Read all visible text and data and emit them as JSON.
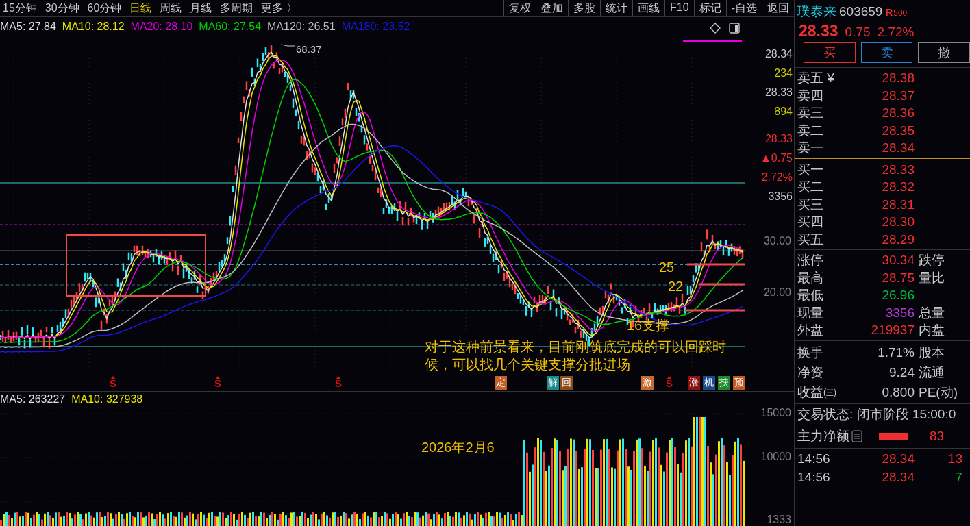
{
  "toolbar": {
    "periods": [
      {
        "label": "15分钟",
        "selected": false
      },
      {
        "label": "30分钟",
        "selected": false
      },
      {
        "label": "60分钟",
        "selected": false
      },
      {
        "label": "日线",
        "selected": true
      },
      {
        "label": "周线",
        "selected": false
      },
      {
        "label": "月线",
        "selected": false
      },
      {
        "label": "多周期",
        "selected": false
      },
      {
        "label": "更多 〉",
        "selected": false
      }
    ],
    "buttons": [
      "复权",
      "叠加",
      "多股",
      "统计",
      "画线",
      "F10",
      "标记",
      "-自选",
      "返回"
    ]
  },
  "legend": [
    {
      "text": "MA5: 27.84",
      "color": "#e0e0e0"
    },
    {
      "text": "MA10: 28.12",
      "color": "#e8e800"
    },
    {
      "text": "MA20: 28.10",
      "color": "#e000e0"
    },
    {
      "text": "MA60: 27.54",
      "color": "#00d000"
    },
    {
      "text": "MA120: 26.51",
      "color": "#bdbdbd"
    },
    {
      "text": "MA180: 23.52",
      "color": "#1818e8"
    }
  ],
  "peak_label": "68.37",
  "price_axis": {
    "info": [
      {
        "text": "28.34",
        "kind": "plain"
      },
      {
        "text": "234",
        "kind": "volume"
      },
      {
        "text": "28.33",
        "kind": "plain"
      },
      {
        "text": "894",
        "kind": "volume"
      },
      {
        "text": "28.33",
        "kind": "up"
      },
      {
        "text": "▲0.75",
        "kind": "up"
      },
      {
        "text": "2.72%",
        "kind": "up"
      },
      {
        "text": "3356",
        "kind": "plain"
      }
    ],
    "ticks": [
      "30.00",
      "20.00"
    ]
  },
  "markers": [
    {
      "kind": "s",
      "label": "S"
    },
    {
      "kind": "s",
      "label": "S"
    },
    {
      "kind": "s",
      "label": "S"
    },
    {
      "kind": "tag",
      "label": "定",
      "color": "#c0602a"
    },
    {
      "kind": "tag",
      "label": "解",
      "color": "#1a8a8a"
    },
    {
      "kind": "tag",
      "label": "回",
      "color": "#8a4a1a"
    },
    {
      "kind": "tag",
      "label": "激",
      "color": "#c8682e"
    },
    {
      "kind": "s",
      "label": "S"
    },
    {
      "kind": "tag",
      "label": "涨",
      "color": "#8a1010"
    },
    {
      "kind": "tag",
      "label": "机",
      "color": "#1a4a8a"
    },
    {
      "kind": "tag",
      "label": "扶",
      "color": "#1a8a2a"
    },
    {
      "kind": "tag",
      "label": "预",
      "color": "#c05a20"
    }
  ],
  "annotations": {
    "labels": [
      "25",
      "22",
      "16支撑"
    ],
    "note": "对于这种前景看来，目前刚筑底完成的可以回踩时候，可以找几个关键支撑分批进场"
  },
  "volume": {
    "legend": [
      {
        "text": "MA5: 263227",
        "color": "#e0e0e0"
      },
      {
        "text": "MA10: 327938",
        "color": "#e8e800"
      }
    ],
    "note": "2026年2月6",
    "ticks": [
      "15000",
      "10000",
      "1333"
    ]
  },
  "panel": {
    "name": "璞泰来",
    "code": "603659",
    "badge_letter": "R",
    "badge": "500",
    "quote": {
      "price": "28.33",
      "change": "0.75",
      "percent": "2.72%"
    },
    "actions": [
      {
        "label": "买",
        "kind": "buy"
      },
      {
        "label": "卖",
        "kind": "sell"
      },
      {
        "label": "撤",
        "kind": "cancel"
      }
    ],
    "asks": [
      {
        "label": "卖五 ¥",
        "price": "28.38"
      },
      {
        "label": "卖四",
        "price": "28.37"
      },
      {
        "label": "卖三",
        "price": "28.36"
      },
      {
        "label": "卖二",
        "price": "28.35"
      },
      {
        "label": "卖一",
        "price": "28.34"
      }
    ],
    "bids": [
      {
        "label": "买一",
        "price": "28.33"
      },
      {
        "label": "买二",
        "price": "28.32"
      },
      {
        "label": "买三",
        "price": "28.31"
      },
      {
        "label": "买四",
        "price": "28.30"
      },
      {
        "label": "买五",
        "price": "28.29"
      }
    ],
    "stats": [
      {
        "label": "涨停",
        "value": "30.34",
        "color": "#f03030",
        "label2": "跌停"
      },
      {
        "label": "最高",
        "value": "28.75",
        "color": "#f03030",
        "label2": "量比"
      },
      {
        "label": "最低",
        "value": "26.96",
        "color": "#00c040"
      },
      {
        "label": "现量",
        "value": "3356",
        "color": "#b040d0",
        "label2": "总量"
      },
      {
        "label": "外盘",
        "value": "219937",
        "color": "#f03030",
        "label2": "内盘"
      }
    ],
    "info": [
      {
        "label": "换手",
        "value": "1.71%",
        "label2": "股本"
      },
      {
        "label": "净资",
        "value": "9.24",
        "label2": "流通"
      },
      {
        "label": "收益㈢",
        "value": "0.800",
        "label2": "PE(动)"
      }
    ],
    "status": "交易状态: 闭市阶段 15:00:0",
    "flow": {
      "label": "主力净额",
      "value": "83"
    },
    "ticks": [
      {
        "time": "14:56",
        "price": "28.34",
        "volume": "13",
        "color": "#f03030"
      },
      {
        "time": "14:56",
        "price": "28.34",
        "volume": "7",
        "color": "#00c040"
      }
    ]
  }
}
